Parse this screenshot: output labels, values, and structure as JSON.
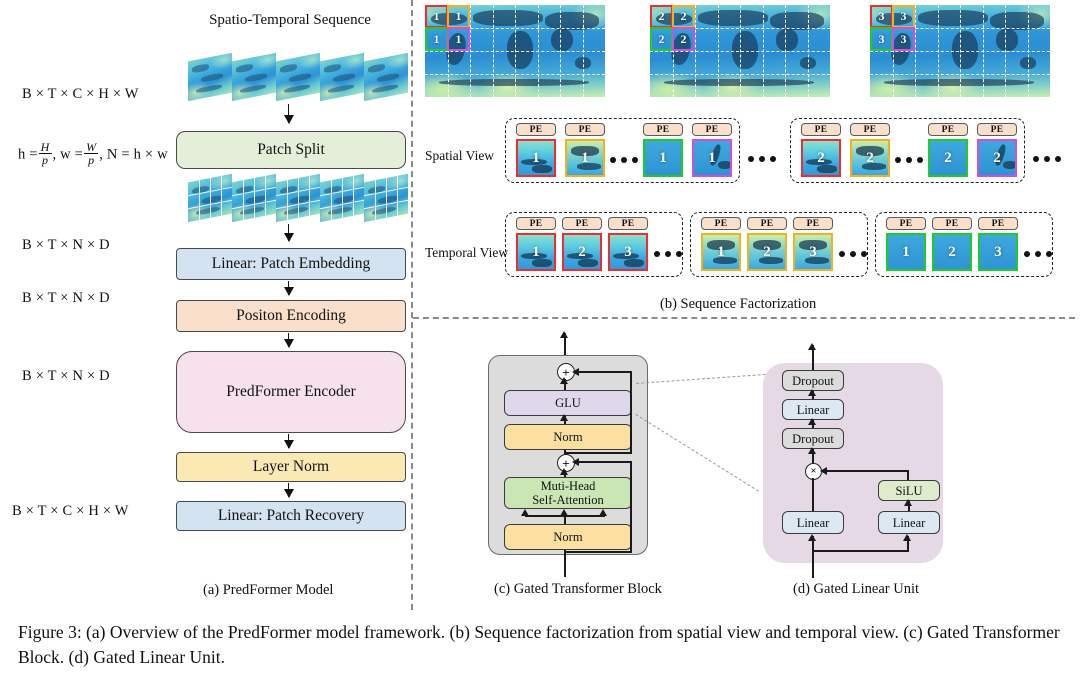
{
  "figure": {
    "caption": "Figure 3: (a) Overview of the PredFormer model framework. (b) Sequence factorization from spatial view and temporal view. (c) Gated Transformer Block. (d) Gated Linear Unit."
  },
  "panel_a": {
    "sub_caption": "(a) PredFormer Model",
    "sequence_title": "Spatio-Temporal Sequence",
    "dims": [
      {
        "text": "B × T × C × H × W"
      },
      {
        "text": "B × T × N × D"
      },
      {
        "text": "B × T × N × D"
      },
      {
        "text": "B × T × N × D"
      },
      {
        "text": "B × T × C × H × W"
      }
    ],
    "patch_formula": {
      "h_label": "h =",
      "h_num": "H",
      "h_den": "p",
      "w_label": ", w =",
      "w_num": "W",
      "w_den": "p",
      "n_label": ", N = h × w"
    },
    "blocks": [
      {
        "label": "Patch Split",
        "color": "#e4eed8"
      },
      {
        "label": "Linear: Patch Embedding",
        "color": "#d3e3f2"
      },
      {
        "label": "Positon Encoding",
        "color": "#fade d3"
      },
      {
        "label": "PredFormer Encoder",
        "color": "#f7e1ec"
      },
      {
        "label": "Layer Norm",
        "color": "#fbe9b4"
      },
      {
        "label": "Linear: Patch Recovery",
        "color": "#d3e3f2"
      }
    ]
  },
  "panel_b": {
    "sub_caption": "(b) Sequence Factorization",
    "row_labels": {
      "spatial": "Spatial View",
      "temporal": "Temporal View"
    },
    "pe_label": "PE",
    "frame_indices": [
      "1",
      "2",
      "3"
    ],
    "patch_colors": {
      "red": "#ef2d2d",
      "orange": "#f5b01e",
      "green": "#22cc26",
      "magenta": "#d24de0"
    },
    "spatial_groups": [
      {
        "frame": "1",
        "tokens": [
          "1",
          "1",
          "1",
          "1"
        ],
        "token_colors": [
          "red",
          "orange",
          "green",
          "magenta"
        ]
      },
      {
        "frame": "2",
        "tokens": [
          "2",
          "2",
          "2",
          "2"
        ],
        "token_colors": [
          "red",
          "orange",
          "green",
          "magenta"
        ]
      }
    ],
    "temporal_groups": [
      {
        "patch": "red",
        "tokens": [
          "1",
          "2",
          "3"
        ]
      },
      {
        "patch": "orange",
        "tokens": [
          "1",
          "2",
          "3"
        ]
      },
      {
        "patch": "green",
        "tokens": [
          "1",
          "2",
          "3"
        ]
      }
    ],
    "maps": [
      {
        "index": "1",
        "cells": [
          "1",
          "1",
          "1",
          "1"
        ]
      },
      {
        "index": "2",
        "cells": [
          "2",
          "2",
          "2",
          "2"
        ]
      },
      {
        "index": "3",
        "cells": [
          "3",
          "3",
          "3",
          "3"
        ]
      }
    ],
    "ellipsis": "•••"
  },
  "panel_c": {
    "sub_caption": "(c) Gated Transformer Block",
    "shell_color": "#dcdcdc",
    "plus_symbol": "+",
    "blocks": [
      {
        "label": "GLU",
        "color": "#dfd8ec"
      },
      {
        "label": "Norm",
        "color": "#fbe0a2"
      },
      {
        "label": "Muti-Head\nSelf-Attention",
        "color": "#c9e6b4"
      },
      {
        "label": "Norm",
        "color": "#fbe0a2"
      }
    ],
    "mhsa_line1": "Muti-Head",
    "mhsa_line2": "Self-Attention"
  },
  "panel_d": {
    "sub_caption": "(d) Gated Linear Unit",
    "shell_color": "#e5d9e6",
    "multiply_symbol": "×",
    "blocks": [
      {
        "label": "Dropout",
        "color": "#dcdcdc"
      },
      {
        "label": "Linear",
        "color": "#dce8f2"
      },
      {
        "label": "Dropout",
        "color": "#dcdcdc"
      },
      {
        "label": "SiLU",
        "color": "#dfeccb"
      },
      {
        "label": "Linear",
        "color": "#dce8f2"
      },
      {
        "label": "Linear",
        "color": "#dce8f2"
      }
    ]
  }
}
